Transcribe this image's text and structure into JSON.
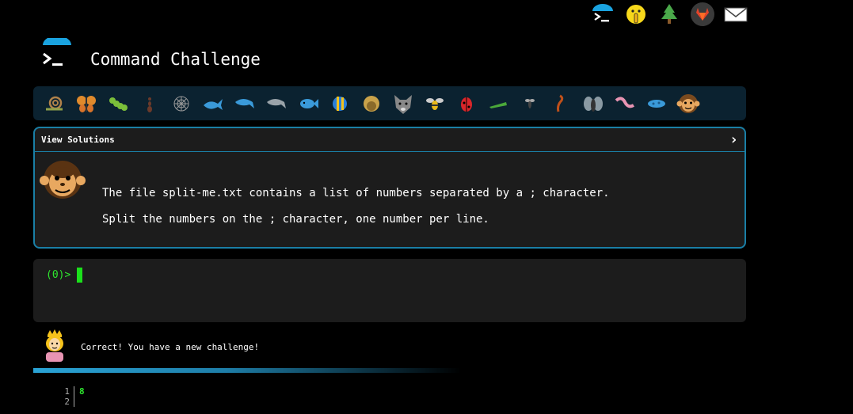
{
  "top_icons": [
    {
      "name": "terminal-logo-icon"
    },
    {
      "name": "shushing-face-icon"
    },
    {
      "name": "tree-icon"
    },
    {
      "name": "gitlab-icon"
    },
    {
      "name": "mail-icon"
    }
  ],
  "header": {
    "title": "Command Challenge"
  },
  "animals": [
    "snail",
    "butterfly",
    "caterpillar",
    "ant",
    "spider-web",
    "whale",
    "dolphin",
    "dolphin-gray",
    "fish",
    "tropical-fish",
    "blowfish",
    "wolf",
    "bee",
    "ladybug",
    "cricket",
    "mosquito",
    "scorpion",
    "fly",
    "worm",
    "microbe",
    "monkey"
  ],
  "challenge": {
    "header_label": "View Solutions",
    "chevron": "›",
    "line1": "The file split-me.txt contains a list of numbers separated by a ; character.",
    "line2": "Split the numbers on the ; character, one number per line."
  },
  "terminal": {
    "prompt": "(0)>"
  },
  "feedback": {
    "message": "Correct! You have a new challenge!"
  },
  "output": {
    "lines": [
      {
        "num": "1",
        "text": "8"
      },
      {
        "num": "2",
        "text": ""
      }
    ]
  },
  "colors": {
    "accent": "#1a7fa6",
    "prompt_green": "#2ee52e",
    "panel": "#1c1c1c",
    "bar": "#0b2230"
  }
}
